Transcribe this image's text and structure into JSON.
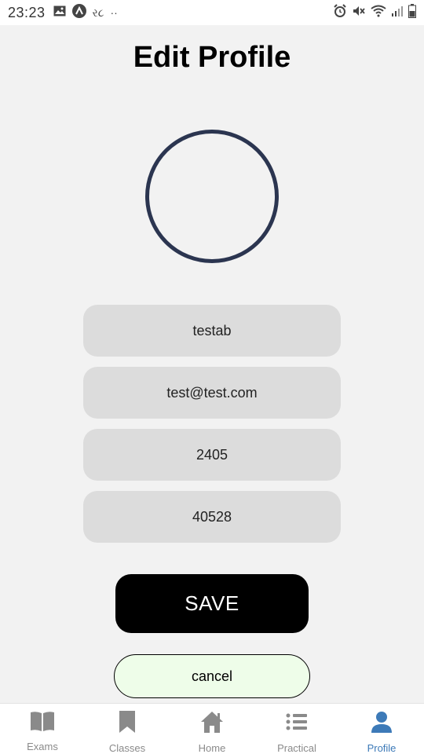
{
  "status_bar": {
    "time": "23:23",
    "carrier_text": "ર૮",
    "dots": "··"
  },
  "page": {
    "title": "Edit Profile"
  },
  "form": {
    "name_value": "testab",
    "email_value": "test@test.com",
    "field3_value": "2405",
    "field4_value": "40528"
  },
  "buttons": {
    "save_label": "SAVE",
    "cancel_label": "cancel"
  },
  "tabbar": {
    "active": "Profile",
    "active_color": "#3d7ab8",
    "tabs": [
      {
        "label": "Exams",
        "icon": "book-icon"
      },
      {
        "label": "Classes",
        "icon": "bookmark-icon"
      },
      {
        "label": "Home",
        "icon": "home-icon"
      },
      {
        "label": "Practical",
        "icon": "list-icon"
      },
      {
        "label": "Profile",
        "icon": "person-icon"
      }
    ]
  },
  "colors": {
    "avatar_ring": "#2b3550",
    "field_bg": "#dcdcdc",
    "save_bg": "#000000",
    "cancel_bg": "#eefde9"
  }
}
